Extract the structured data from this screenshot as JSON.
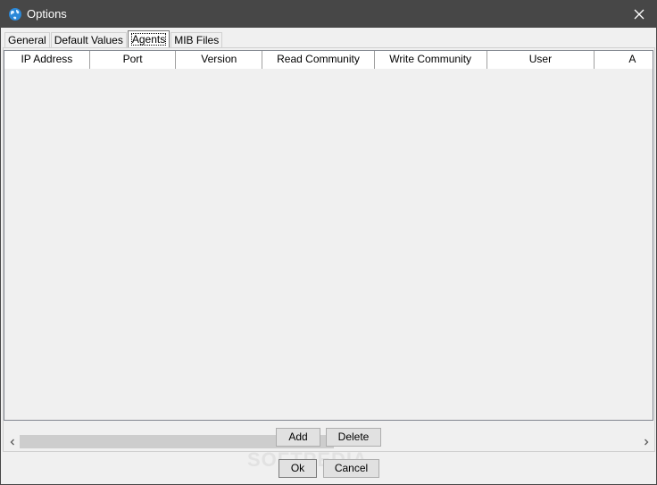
{
  "window": {
    "title": "Options",
    "icon": "globe-icon",
    "close_icon": "close-icon"
  },
  "tabs": [
    {
      "label": "General",
      "active": false
    },
    {
      "label": "Default Values",
      "active": false
    },
    {
      "label": "Agents",
      "active": true
    },
    {
      "label": "MIB Files",
      "active": false
    }
  ],
  "agents_table": {
    "columns": [
      "IP Address",
      "Port",
      "Version",
      "Read Community",
      "Write Community",
      "User",
      "A"
    ],
    "rows": []
  },
  "panel_buttons": {
    "add_label": "Add",
    "delete_label": "Delete"
  },
  "dialog_buttons": {
    "ok_label": "Ok",
    "cancel_label": "Cancel"
  },
  "watermark": "SOFTPEDIA",
  "colors": {
    "titlebar": "#474747",
    "header_bg": "#ffffff",
    "scroll_thumb": "#cdcdcd"
  }
}
